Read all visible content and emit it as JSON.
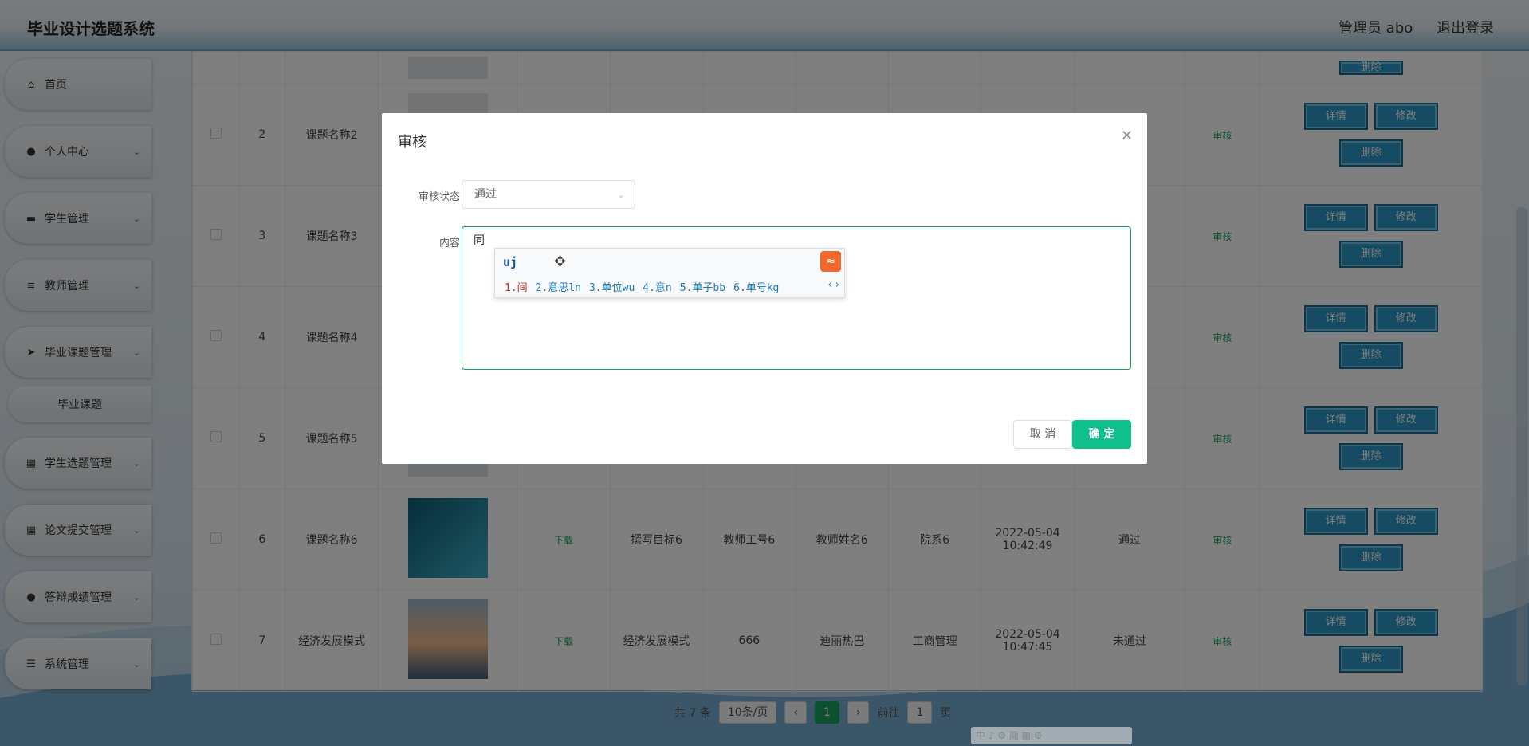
{
  "app": {
    "title": "毕业设计选题系统",
    "user": "管理员 abo",
    "logout": "退出登录"
  },
  "sidebar": {
    "items": [
      {
        "label": "首页",
        "icon": "home-icon"
      },
      {
        "label": "个人中心",
        "icon": "user-icon"
      },
      {
        "label": "学生管理",
        "icon": "briefcase-icon"
      },
      {
        "label": "教师管理",
        "icon": "list-icon"
      },
      {
        "label": "毕业课题管理",
        "icon": "send-icon"
      },
      {
        "label": "学生选题管理",
        "icon": "grid-icon"
      },
      {
        "label": "论文提交管理",
        "icon": "grid-icon"
      },
      {
        "label": "答辩成绩管理",
        "icon": "pin-icon"
      },
      {
        "label": "系统管理",
        "icon": "sliders-icon"
      }
    ],
    "sub_item": "毕业课题"
  },
  "table": {
    "rows": [
      {
        "no": "2",
        "name": "课题名称2",
        "download": "",
        "goal": "",
        "tid": "",
        "tname": "",
        "dept": "",
        "time": "",
        "status": ""
      },
      {
        "no": "3",
        "name": "课题名称3",
        "download": "",
        "goal": "",
        "tid": "",
        "tname": "",
        "dept": "",
        "time": "",
        "status": ""
      },
      {
        "no": "4",
        "name": "课题名称4",
        "download": "",
        "goal": "",
        "tid": "",
        "tname": "",
        "dept": "",
        "time": "",
        "status": ""
      },
      {
        "no": "5",
        "name": "课题名称5",
        "download": "",
        "goal": "",
        "tid": "",
        "tname": "",
        "dept": "",
        "time": "",
        "status": ""
      },
      {
        "no": "6",
        "name": "课题名称6",
        "download": "下载",
        "goal": "撰写目标6",
        "tid": "教师工号6",
        "tname": "教师姓名6",
        "dept": "院系6",
        "time": "2022-05-04 10:42:49",
        "status": "通过"
      },
      {
        "no": "7",
        "name": "经济发展模式",
        "download": "下载",
        "goal": "经济发展模式",
        "tid": "666",
        "tname": "迪丽热巴",
        "dept": "工商管理",
        "time": "2022-05-04 10:47:45",
        "status": "未通过"
      }
    ],
    "audit_link": "审核",
    "detail_btn": "详情",
    "edit_btn": "修改",
    "delete_btn": "删除",
    "top_delete_btn": "删除"
  },
  "pager": {
    "total": "共 7 条",
    "size": "10条/页",
    "current": "1",
    "goto": "前往",
    "page_input": "1",
    "page_unit": "页"
  },
  "dialog": {
    "title": "审核",
    "status_label": "审核状态",
    "status_value": "通过",
    "content_label": "内容",
    "content_value": "同",
    "cancel": "取 消",
    "confirm": "确 定"
  },
  "ime": {
    "input": "uj",
    "candidates": [
      "1.间",
      "2.意思ln",
      "3.单位wu",
      "4.意n",
      "5.单子bb",
      "6.单号kg"
    ],
    "nav": "‹ ›",
    "toolbar": "中 ♪ ⚙ 简 ▦ ⚙"
  },
  "colors": {
    "accent": "#17a35e",
    "primary_btn": "#2b98c7",
    "confirm": "#0fbf8c"
  }
}
